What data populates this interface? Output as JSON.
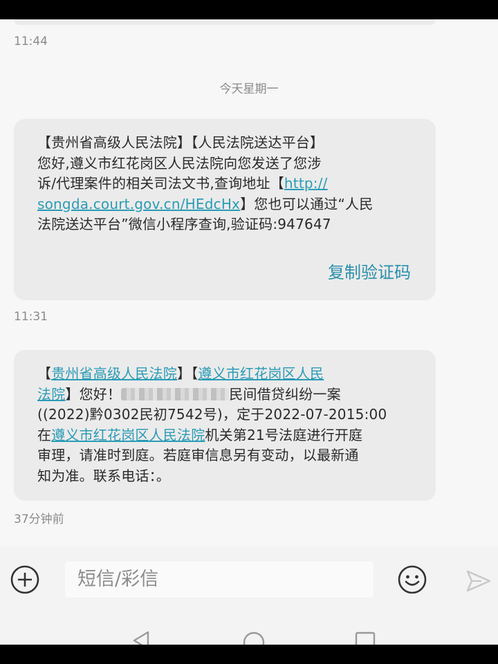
{
  "thread": {
    "time_1": "11:44",
    "day_separator": "今天星期一",
    "message_1": {
      "lines": [
        "【贵州省高级人民法院】【人民法院送达平台】",
        "您好,遵义市红花岗区人民法院向您发送了您涉",
        "诉/代理案件的相关司法文书,查询地址【",
        "】您也可以通过“人民",
        "法院送达平台”微信小程序查询,验证码:947647"
      ],
      "link_part1": "http://",
      "link_part2": "songda.court.gov.cn/HEdcHx",
      "action_label": "复制验证码"
    },
    "time_2": "11:31",
    "message_2": {
      "bracket_open": "【",
      "court_link": "贵州省高级人民法院",
      "bracket_mid": "】【",
      "district_court_link_a": "遵义市红花岗区人民",
      "district_court_link_b": "法院",
      "text_after_court": "】您好！",
      "text_after_redaction": "民间借贷纠纷一案",
      "case_line": "((2022)黔0302民初7542号)，定于2022-07-2015:00",
      "prefix_zai": "在",
      "district_court_link_full": "遵义市红花岗区人民法院",
      "text_after_court_2": "机关第21号法庭进行开庭",
      "line_5": "审理，请准时到庭。若庭审信息另有变动，以最新通",
      "line_6": "知为准。联系电话：。"
    },
    "time_3": "37分钟前"
  },
  "composer": {
    "placeholder": "短信/彩信",
    "add_icon": "plus-circle-icon",
    "emoji_icon": "smiley-icon",
    "send_icon": "send-arrow-icon"
  },
  "nav": {
    "back_icon": "back-triangle-icon",
    "home_icon": "home-circle-icon",
    "recents_icon": "recents-square-icon"
  },
  "colors": {
    "link": "#2a9bb6",
    "action": "#2a8fac",
    "bubble": "#ebebeb",
    "background": "#f7f7f7"
  }
}
